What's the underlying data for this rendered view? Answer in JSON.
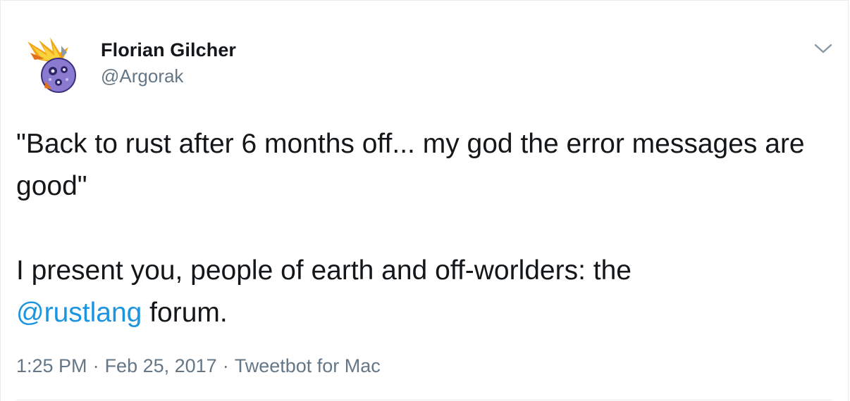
{
  "author": {
    "display_name": "Florian Gilcher",
    "handle": "@Argorak",
    "avatar_icon": "flaming-meteor-avatar"
  },
  "tweet": {
    "paragraph1": "\"Back to rust after 6 months off... my god the error messages are good\"",
    "paragraph2_text": "I present you, people of earth and off-worlders: the",
    "mention": "@rustlang",
    "paragraph2_tail": " forum."
  },
  "meta": {
    "time": "1:25 PM",
    "separator": "·",
    "date": "Feb 25, 2017",
    "source": "Tweetbot for Mac"
  },
  "menu_icon": "chevron-down-icon",
  "colors": {
    "text": "#14171a",
    "secondary": "#657786",
    "link": "#1b95e0",
    "border": "#e6ecf0"
  }
}
